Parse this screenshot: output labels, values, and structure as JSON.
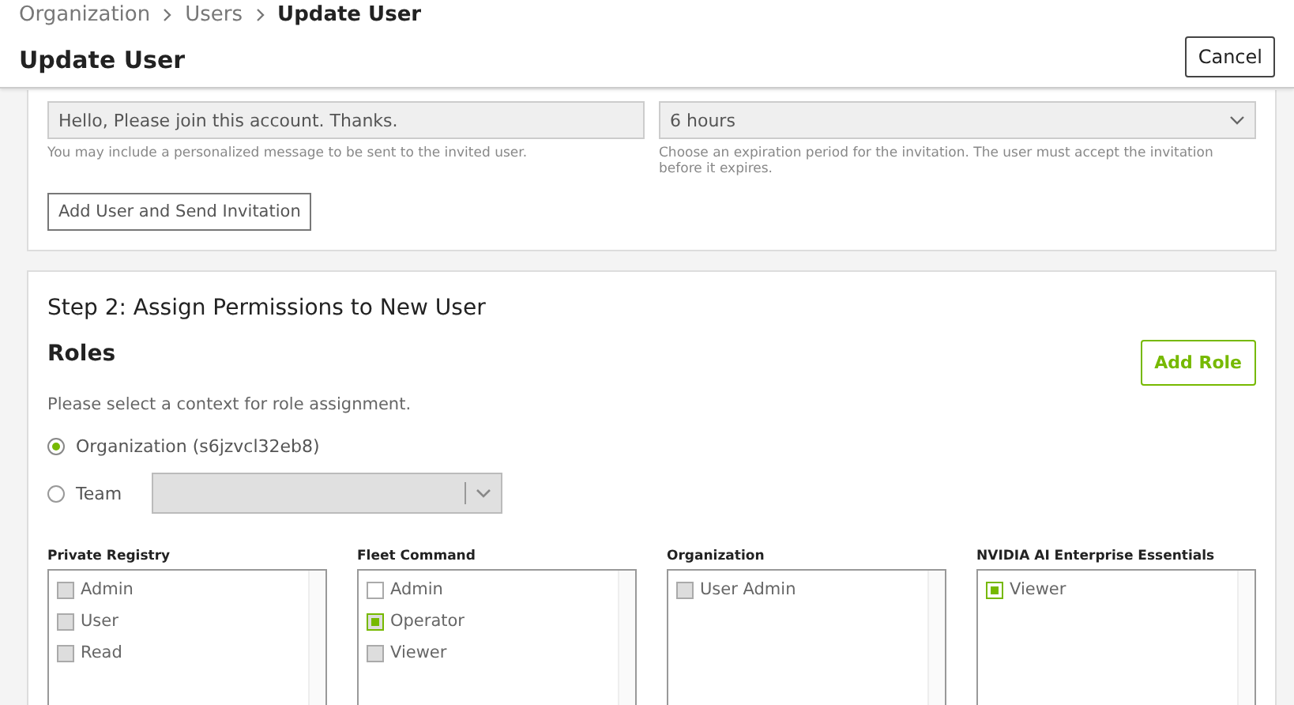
{
  "breadcrumb": [
    "Organization",
    "Users",
    "Update User"
  ],
  "title": "Update User",
  "cancel_button": "Cancel",
  "invitation": {
    "message": {
      "value": "Hello, Please join this account. Thanks.",
      "help": "You may include a personalized message to be sent to the invited user."
    },
    "expiry": {
      "value": "6 hours",
      "help": "Choose an expiration period for the invitation. The user must accept the invitation before it expires."
    },
    "submit_button": "Add User and Send Invitation"
  },
  "step2": {
    "title": "Step 2: Assign Permissions to New User",
    "roles_heading": "Roles",
    "add_role_button": "Add Role",
    "hint": "Please select a context for role assignment.",
    "contexts": [
      {
        "label": "Organization (s6jzvcl32eb8)",
        "selected": true,
        "kind": "plain"
      },
      {
        "label": "Team",
        "selected": false,
        "kind": "select"
      }
    ],
    "role_groups": [
      {
        "title": "Private Registry",
        "items": [
          {
            "label": "Admin",
            "checked": false,
            "disabled": true
          },
          {
            "label": "User",
            "checked": false,
            "disabled": true
          },
          {
            "label": "Read",
            "checked": false,
            "disabled": true
          }
        ]
      },
      {
        "title": "Fleet Command",
        "items": [
          {
            "label": "Admin",
            "checked": false,
            "disabled": false
          },
          {
            "label": "Operator",
            "checked": true,
            "disabled": true
          },
          {
            "label": "Viewer",
            "checked": false,
            "disabled": true
          }
        ]
      },
      {
        "title": "Organization",
        "items": [
          {
            "label": "User Admin",
            "checked": false,
            "disabled": true
          }
        ]
      },
      {
        "title": "NVIDIA AI Enterprise Essentials",
        "items": [
          {
            "label": "Viewer",
            "checked": true,
            "disabled": false
          }
        ]
      }
    ]
  }
}
